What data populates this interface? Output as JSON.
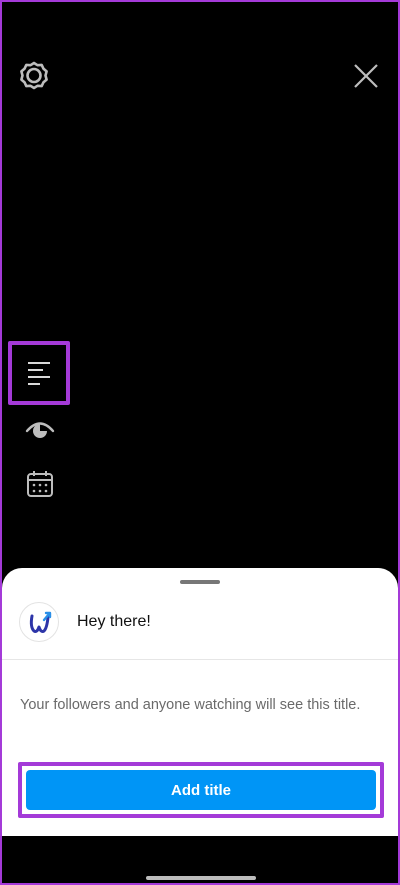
{
  "header": {
    "settings_icon": "settings-gear-icon",
    "close_icon": "close-icon"
  },
  "side_tools": [
    {
      "icon": "title-lines-icon",
      "highlighted": true
    },
    {
      "icon": "visibility-eye-icon",
      "highlighted": false
    },
    {
      "icon": "calendar-icon",
      "highlighted": false
    }
  ],
  "sheet": {
    "username": "Hey there!",
    "description": "Your followers and anyone watching will see this title.",
    "button_label": "Add title"
  },
  "colors": {
    "highlight": "#a43ad8",
    "primary_button": "#0095f6",
    "background": "#000000",
    "sheet": "#ffffff"
  }
}
